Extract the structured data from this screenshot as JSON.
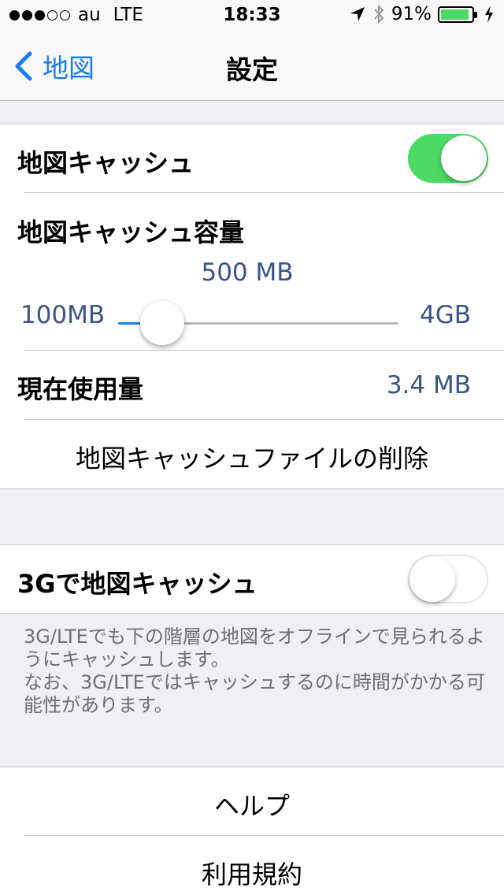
{
  "status_bar": {
    "signal_total": 5,
    "signal_active": 3,
    "carrier": "au",
    "network": "LTE",
    "time": "18:33",
    "battery": "91%",
    "battery_level": 0.91,
    "icons": [
      "location-arrow-icon",
      "bluetooth-icon",
      "battery-icon",
      "charging-bolt-icon"
    ]
  },
  "nav": {
    "back_label": "地図",
    "title": "設定"
  },
  "colors": {
    "accent": "#1a7cf5",
    "toggle_on": "#4cd964",
    "value_text": "#385487",
    "background": "#efeff4"
  },
  "cache_group": {
    "cache_label": "地図キャッシュ",
    "cache_on": true,
    "capacity_label": "地図キャッシュ容量",
    "capacity_value": "500 MB",
    "slider_min_label": "100MB",
    "slider_max_label": "4GB",
    "slider_level": 0.08,
    "usage_label": "現在使用量",
    "usage_value": "3.4 MB",
    "delete_label": "地図キャッシュファイルの削除"
  },
  "cellular_group": {
    "label": "3Gで地図キャッシュ",
    "enabled": false,
    "footnote_line1": "3G/LTEでも下の階層の地図をオフラインで見られるようにキャッシュします。",
    "footnote_line2": "なお、3G/LTEではキャッシュするのに時間がかかる可能性があります。"
  },
  "links_group": {
    "help_label": "ヘルプ",
    "terms_label": "利用規約"
  }
}
